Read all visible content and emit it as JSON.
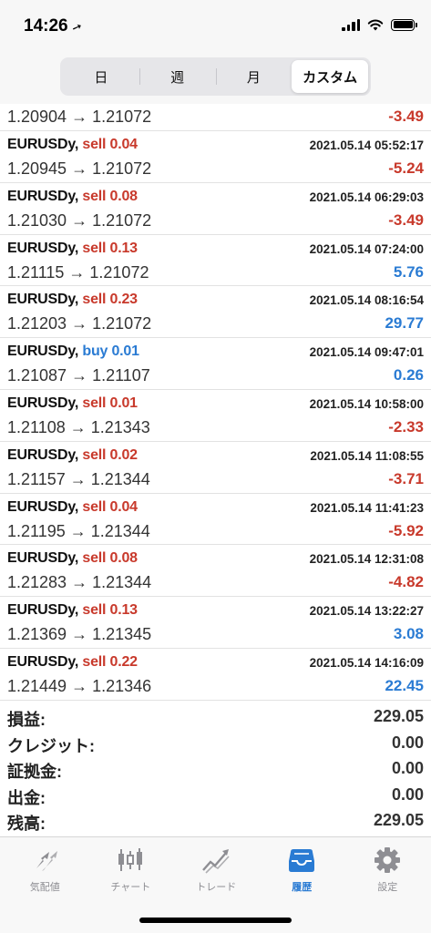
{
  "status_bar": {
    "time": "14:26",
    "location_glyph": "➚"
  },
  "segments": [
    {
      "label": "日",
      "active": false
    },
    {
      "label": "週",
      "active": false
    },
    {
      "label": "月",
      "active": false
    },
    {
      "label": "カスタム",
      "active": true
    }
  ],
  "partial_row": {
    "prices": "1.20904 → 1.21072",
    "profit": "-3.49"
  },
  "deals": [
    {
      "symbol": "EURUSDy,",
      "type": "sell 0.04",
      "time": "2021.05.14 05:52:17",
      "prices": "1.20945 → 1.21072",
      "profit": "-5.24",
      "profit_sign": "neg",
      "type_class": "type-sell"
    },
    {
      "symbol": "EURUSDy,",
      "type": "sell 0.08",
      "time": "2021.05.14 06:29:03",
      "prices": "1.21030 → 1.21072",
      "profit": "-3.49",
      "profit_sign": "neg",
      "type_class": "type-sell"
    },
    {
      "symbol": "EURUSDy,",
      "type": "sell 0.13",
      "time": "2021.05.14 07:24:00",
      "prices": "1.21115 → 1.21072",
      "profit": "5.76",
      "profit_sign": "pos",
      "type_class": "type-sell"
    },
    {
      "symbol": "EURUSDy,",
      "type": "sell 0.23",
      "time": "2021.05.14 08:16:54",
      "prices": "1.21203 → 1.21072",
      "profit": "29.77",
      "profit_sign": "pos",
      "type_class": "type-sell"
    },
    {
      "symbol": "EURUSDy,",
      "type": "buy 0.01",
      "time": "2021.05.14 09:47:01",
      "prices": "1.21087 → 1.21107",
      "profit": "0.26",
      "profit_sign": "pos",
      "type_class": "type-buy"
    },
    {
      "symbol": "EURUSDy,",
      "type": "sell 0.01",
      "time": "2021.05.14 10:58:00",
      "prices": "1.21108 → 1.21343",
      "profit": "-2.33",
      "profit_sign": "neg",
      "type_class": "type-sell"
    },
    {
      "symbol": "EURUSDy,",
      "type": "sell 0.02",
      "time": "2021.05.14 11:08:55",
      "prices": "1.21157 → 1.21344",
      "profit": "-3.71",
      "profit_sign": "neg",
      "type_class": "type-sell"
    },
    {
      "symbol": "EURUSDy,",
      "type": "sell 0.04",
      "time": "2021.05.14 11:41:23",
      "prices": "1.21195 → 1.21344",
      "profit": "-5.92",
      "profit_sign": "neg",
      "type_class": "type-sell"
    },
    {
      "symbol": "EURUSDy,",
      "type": "sell 0.08",
      "time": "2021.05.14 12:31:08",
      "prices": "1.21283 → 1.21344",
      "profit": "-4.82",
      "profit_sign": "neg",
      "type_class": "type-sell"
    },
    {
      "symbol": "EURUSDy,",
      "type": "sell 0.13",
      "time": "2021.05.14 13:22:27",
      "prices": "1.21369 → 1.21345",
      "profit": "3.08",
      "profit_sign": "pos",
      "type_class": "type-sell"
    },
    {
      "symbol": "EURUSDy,",
      "type": "sell 0.22",
      "time": "2021.05.14 14:16:09",
      "prices": "1.21449 → 1.21346",
      "profit": "22.45",
      "profit_sign": "pos",
      "type_class": "type-sell"
    }
  ],
  "summary": [
    {
      "label": "損益:",
      "value": "229.05"
    },
    {
      "label": "クレジット:",
      "value": "0.00"
    },
    {
      "label": "証拠金:",
      "value": "0.00"
    },
    {
      "label": "出金:",
      "value": "0.00"
    },
    {
      "label": "残高:",
      "value": "229.05"
    }
  ],
  "tabs": [
    {
      "label": "気配値",
      "icon": "quotes-icon",
      "active": false
    },
    {
      "label": "チャート",
      "icon": "chart-icon",
      "active": false
    },
    {
      "label": "トレード",
      "icon": "trade-icon",
      "active": false
    },
    {
      "label": "履歴",
      "icon": "history-icon",
      "active": true
    },
    {
      "label": "設定",
      "icon": "settings-icon",
      "active": false
    }
  ],
  "colors": {
    "sell": "#c8392b",
    "buy": "#2a7bd3",
    "negative": "#c8392b",
    "positive": "#2a7bd3",
    "tab_active": "#2a7bd3",
    "tab_inactive": "#8e8e93"
  }
}
